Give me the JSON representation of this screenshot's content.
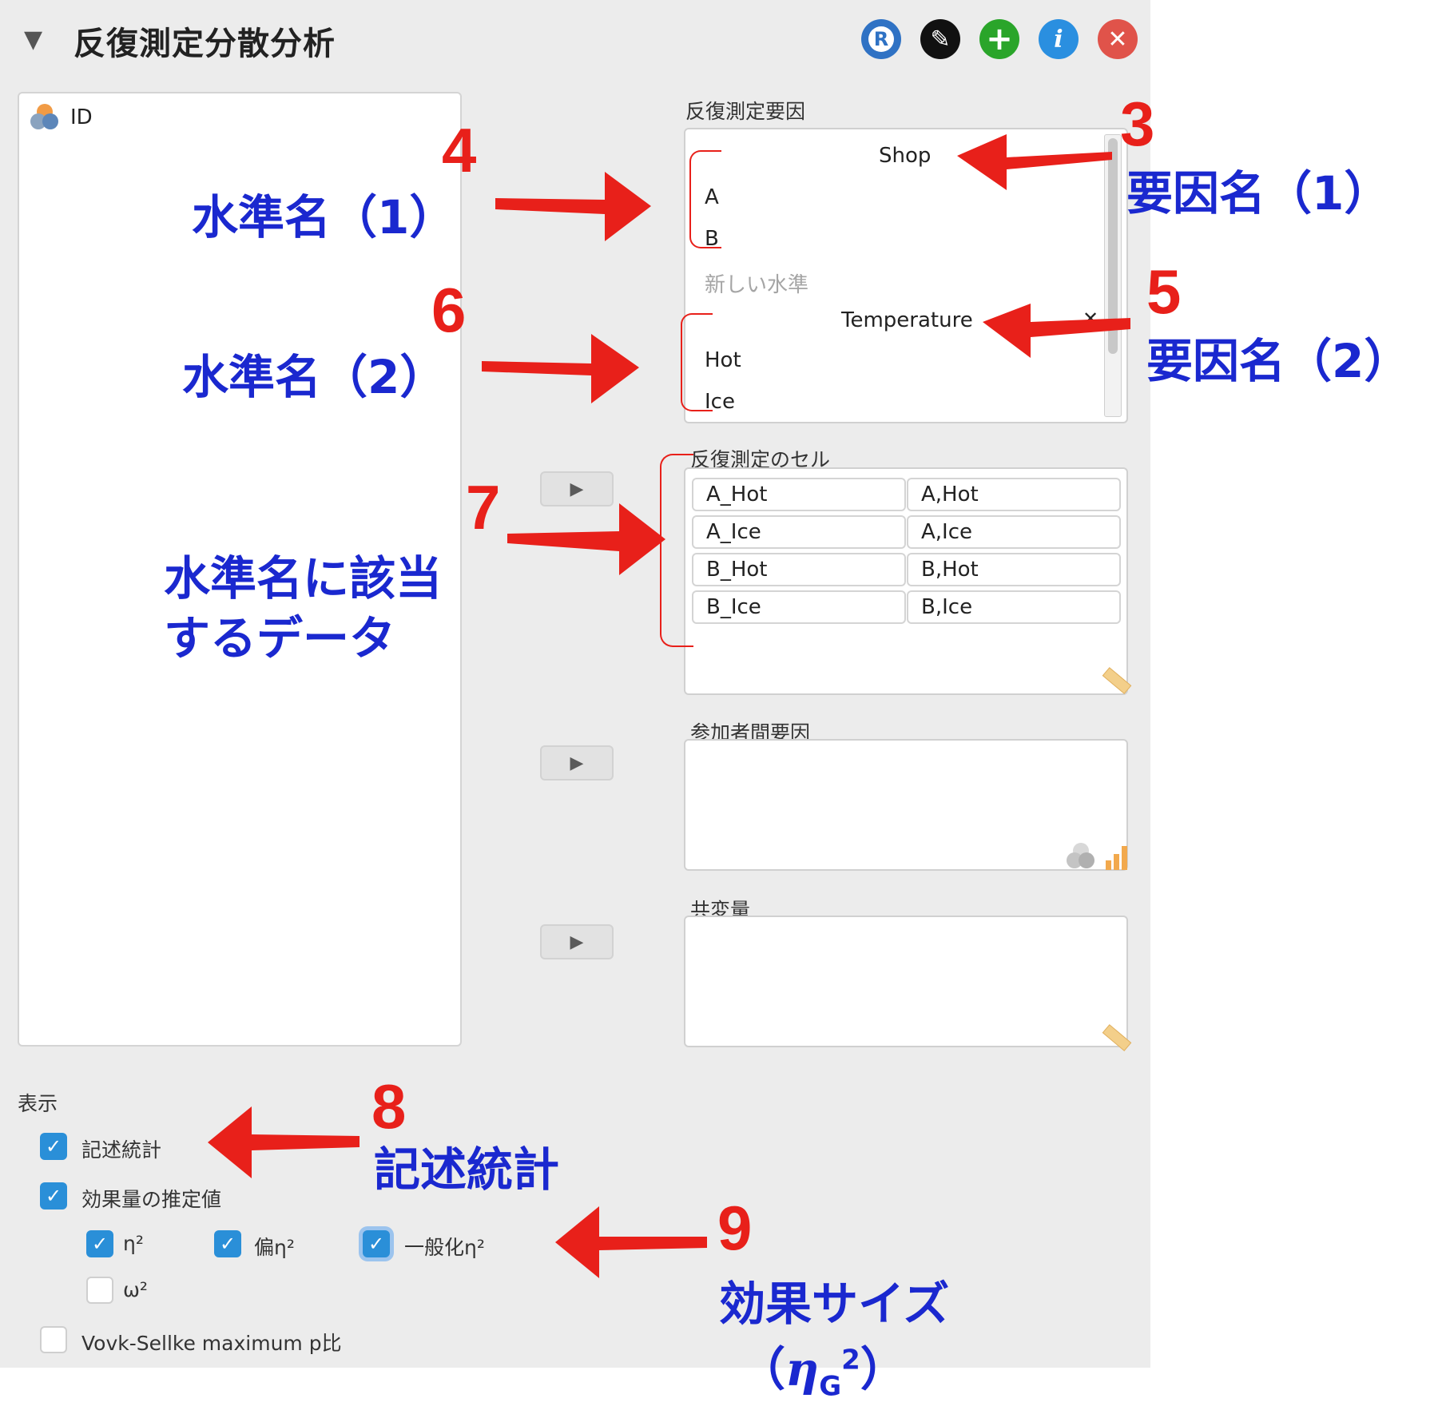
{
  "header": {
    "collapse_glyph": "▼",
    "title": "反復測定分散分析",
    "buttons": {
      "r_label": "R",
      "edit_glyph": "✎",
      "add_glyph": "+",
      "info_label": "i",
      "close_glyph": "✕"
    }
  },
  "variables": {
    "items": [
      {
        "label": "ID",
        "icon": "nominal-variable-icon"
      }
    ]
  },
  "rm_factors": {
    "label": "反復測定要因",
    "factors": [
      {
        "name": "Shop",
        "levels": [
          "A",
          "B"
        ],
        "new_level_placeholder": "新しい水準"
      },
      {
        "name": "Temperature",
        "levels": [
          "Hot",
          "Ice"
        ],
        "remove_glyph": "✕"
      }
    ]
  },
  "rm_cells": {
    "label": "反復測定のセル",
    "rows": [
      {
        "variable": "A_Hot",
        "cell": "A,Hot"
      },
      {
        "variable": "A_Ice",
        "cell": "A,Ice"
      },
      {
        "variable": "B_Hot",
        "cell": "B,Hot"
      },
      {
        "variable": "B_Ice",
        "cell": "B,Ice"
      }
    ]
  },
  "between": {
    "label": "参加者間要因"
  },
  "covariates": {
    "label": "共変量"
  },
  "move_button_glyph": "▶",
  "display": {
    "label": "表示",
    "descriptives": {
      "label": "記述統計",
      "checked": true
    },
    "effect_size": {
      "label": "効果量の推定値",
      "checked": true
    },
    "eta_sq": {
      "label": "η²",
      "checked": true
    },
    "partial_eta_sq": {
      "label": "偏η²",
      "checked": true
    },
    "general_eta_sq": {
      "label": "一般化η²",
      "checked": true
    },
    "omega_sq": {
      "label": "ω²",
      "checked": false
    },
    "vovk_sellke": {
      "label": "Vovk-Sellke maximum p比",
      "checked": false
    },
    "check_glyph": "✓"
  },
  "annotations": {
    "n3": "3",
    "factor_name_1": "要因名（1）",
    "n4": "4",
    "level_name_1": "水準名（1）",
    "n5": "5",
    "factor_name_2": "要因名（2）",
    "n6": "6",
    "level_name_2": "水準名（2）",
    "n7": "7",
    "data_line1": "水準名に該当",
    "data_line2": "するデータ",
    "n8": "8",
    "descriptives": "記述統計",
    "n9": "9",
    "effect_size": "効果サイズ",
    "eta_open": "（",
    "eta_symbol": "η",
    "eta_sub": "G",
    "eta_sup": "2",
    "eta_close": "）"
  },
  "colors": {
    "annotation_number": "#e8201a",
    "annotation_text": "#1a28cf",
    "checkbox_on": "#2a8fd8",
    "panel_bg": "#ececec"
  }
}
